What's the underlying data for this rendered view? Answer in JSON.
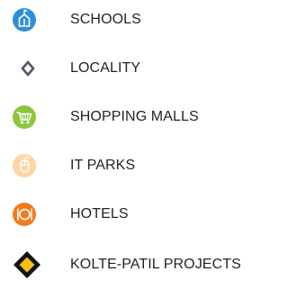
{
  "legend": {
    "items": [
      {
        "icon": "school-icon",
        "label": "SCHOOLS",
        "color": "#2f8fd6"
      },
      {
        "icon": "locality-diamond-icon",
        "label": "LOCALITY",
        "color": "#505765"
      },
      {
        "icon": "shopping-cart-icon",
        "label": "SHOPPING MALLS",
        "color": "#8cc63f"
      },
      {
        "icon": "mouse-icon",
        "label": "IT PARKS",
        "color": "#fdd6a4"
      },
      {
        "icon": "hotel-plate-icon",
        "label": "HOTELS",
        "color": "#f47a20"
      },
      {
        "icon": "project-diamond-icon",
        "label": "KOLTE-PATIL PROJECTS",
        "color": "#f8c00d"
      }
    ]
  }
}
